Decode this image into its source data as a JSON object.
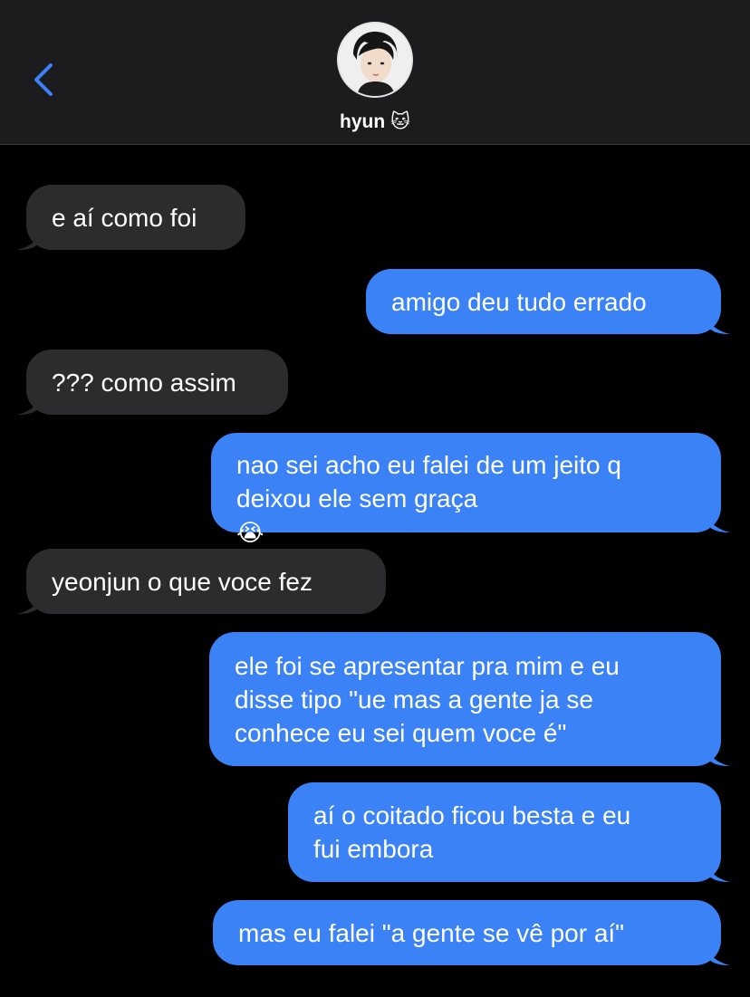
{
  "header": {
    "contact_name": "hyun",
    "contact_emoji": "🐱",
    "back_icon": "chevron-left-icon",
    "accent_color": "#3a82f6"
  },
  "messages": [
    {
      "from": "them",
      "text": "e aí como foi"
    },
    {
      "from": "me",
      "text": "amigo deu tudo errado"
    },
    {
      "from": "them",
      "text": "??? como assim"
    },
    {
      "from": "me",
      "text": "nao sei acho eu falei de um jeito q\ndeixou ele sem graça",
      "emoji": "😭"
    },
    {
      "from": "them",
      "text": "yeonjun o que voce fez"
    },
    {
      "from": "me",
      "text": "ele foi se apresentar pra mim e eu\ndisse tipo \"ue mas a gente ja se\nconhece eu sei quem voce é\""
    },
    {
      "from": "me",
      "text": "aí o coitado ficou besta e eu\nfui embora"
    },
    {
      "from": "me",
      "text": "mas eu falei \"a gente se vê por aí\""
    }
  ]
}
